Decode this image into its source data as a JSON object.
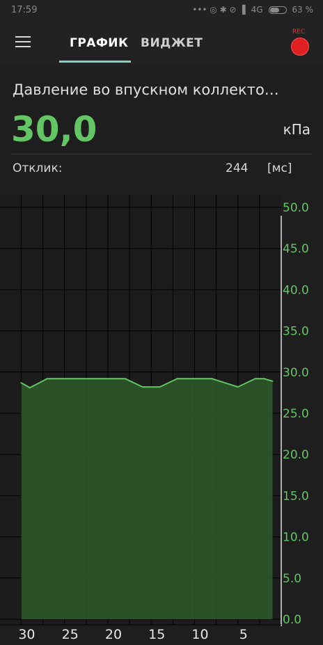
{
  "status_bar": {
    "time": "17:59",
    "icons": "•••  ◎  ✱  ⊘  ▐",
    "network": "4G",
    "battery_text": "63 %",
    "battery_level": 0.63
  },
  "app_bar": {
    "tabs": [
      {
        "label": "ГРАФИК",
        "active": true
      },
      {
        "label": "ВИДЖЕТ",
        "active": false
      }
    ],
    "rec_label": "REC"
  },
  "sensor": {
    "name": "Давление во впускном коллекто…",
    "value": "30,0",
    "unit": "кПа",
    "response_label": "Отклик:",
    "response_value": "244",
    "response_unit": "[мс]"
  },
  "colors": {
    "accent_green": "#63c564",
    "tab_indicator": "#7fd3c7",
    "rec_red": "#e02020",
    "area_fill": "#2e5a2b",
    "grid": "#000000"
  },
  "chart_data": {
    "type": "area",
    "x": [
      30,
      29,
      27,
      25,
      23,
      20,
      18,
      16,
      14,
      12,
      10,
      8,
      5,
      3,
      2,
      1
    ],
    "values": [
      28.7,
      28.1,
      29.2,
      29.2,
      29.2,
      29.2,
      29.2,
      28.2,
      28.2,
      29.2,
      29.2,
      29.2,
      28.2,
      29.2,
      29.2,
      28.9
    ],
    "xlim": [
      31,
      0
    ],
    "ylim": [
      0,
      50
    ],
    "x_ticks": [
      "30",
      "25",
      "20",
      "15",
      "10",
      "5"
    ],
    "y_ticks": [
      "50.0",
      "45.0",
      "40.0",
      "35.0",
      "30.0",
      "25.0",
      "20.0",
      "15.0",
      "10.0",
      "5.0",
      "0.0"
    ],
    "grid": true,
    "y_axis_position": "right"
  }
}
